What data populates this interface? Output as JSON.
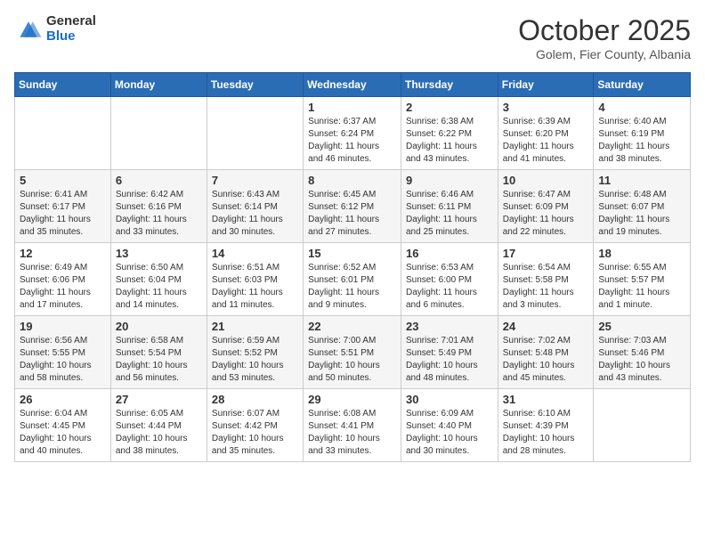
{
  "header": {
    "logo_general": "General",
    "logo_blue": "Blue",
    "month": "October 2025",
    "location": "Golem, Fier County, Albania"
  },
  "weekdays": [
    "Sunday",
    "Monday",
    "Tuesday",
    "Wednesday",
    "Thursday",
    "Friday",
    "Saturday"
  ],
  "weeks": [
    [
      {
        "day": "",
        "info": ""
      },
      {
        "day": "",
        "info": ""
      },
      {
        "day": "",
        "info": ""
      },
      {
        "day": "1",
        "info": "Sunrise: 6:37 AM\nSunset: 6:24 PM\nDaylight: 11 hours\nand 46 minutes."
      },
      {
        "day": "2",
        "info": "Sunrise: 6:38 AM\nSunset: 6:22 PM\nDaylight: 11 hours\nand 43 minutes."
      },
      {
        "day": "3",
        "info": "Sunrise: 6:39 AM\nSunset: 6:20 PM\nDaylight: 11 hours\nand 41 minutes."
      },
      {
        "day": "4",
        "info": "Sunrise: 6:40 AM\nSunset: 6:19 PM\nDaylight: 11 hours\nand 38 minutes."
      }
    ],
    [
      {
        "day": "5",
        "info": "Sunrise: 6:41 AM\nSunset: 6:17 PM\nDaylight: 11 hours\nand 35 minutes."
      },
      {
        "day": "6",
        "info": "Sunrise: 6:42 AM\nSunset: 6:16 PM\nDaylight: 11 hours\nand 33 minutes."
      },
      {
        "day": "7",
        "info": "Sunrise: 6:43 AM\nSunset: 6:14 PM\nDaylight: 11 hours\nand 30 minutes."
      },
      {
        "day": "8",
        "info": "Sunrise: 6:45 AM\nSunset: 6:12 PM\nDaylight: 11 hours\nand 27 minutes."
      },
      {
        "day": "9",
        "info": "Sunrise: 6:46 AM\nSunset: 6:11 PM\nDaylight: 11 hours\nand 25 minutes."
      },
      {
        "day": "10",
        "info": "Sunrise: 6:47 AM\nSunset: 6:09 PM\nDaylight: 11 hours\nand 22 minutes."
      },
      {
        "day": "11",
        "info": "Sunrise: 6:48 AM\nSunset: 6:07 PM\nDaylight: 11 hours\nand 19 minutes."
      }
    ],
    [
      {
        "day": "12",
        "info": "Sunrise: 6:49 AM\nSunset: 6:06 PM\nDaylight: 11 hours\nand 17 minutes."
      },
      {
        "day": "13",
        "info": "Sunrise: 6:50 AM\nSunset: 6:04 PM\nDaylight: 11 hours\nand 14 minutes."
      },
      {
        "day": "14",
        "info": "Sunrise: 6:51 AM\nSunset: 6:03 PM\nDaylight: 11 hours\nand 11 minutes."
      },
      {
        "day": "15",
        "info": "Sunrise: 6:52 AM\nSunset: 6:01 PM\nDaylight: 11 hours\nand 9 minutes."
      },
      {
        "day": "16",
        "info": "Sunrise: 6:53 AM\nSunset: 6:00 PM\nDaylight: 11 hours\nand 6 minutes."
      },
      {
        "day": "17",
        "info": "Sunrise: 6:54 AM\nSunset: 5:58 PM\nDaylight: 11 hours\nand 3 minutes."
      },
      {
        "day": "18",
        "info": "Sunrise: 6:55 AM\nSunset: 5:57 PM\nDaylight: 11 hours\nand 1 minute."
      }
    ],
    [
      {
        "day": "19",
        "info": "Sunrise: 6:56 AM\nSunset: 5:55 PM\nDaylight: 10 hours\nand 58 minutes."
      },
      {
        "day": "20",
        "info": "Sunrise: 6:58 AM\nSunset: 5:54 PM\nDaylight: 10 hours\nand 56 minutes."
      },
      {
        "day": "21",
        "info": "Sunrise: 6:59 AM\nSunset: 5:52 PM\nDaylight: 10 hours\nand 53 minutes."
      },
      {
        "day": "22",
        "info": "Sunrise: 7:00 AM\nSunset: 5:51 PM\nDaylight: 10 hours\nand 50 minutes."
      },
      {
        "day": "23",
        "info": "Sunrise: 7:01 AM\nSunset: 5:49 PM\nDaylight: 10 hours\nand 48 minutes."
      },
      {
        "day": "24",
        "info": "Sunrise: 7:02 AM\nSunset: 5:48 PM\nDaylight: 10 hours\nand 45 minutes."
      },
      {
        "day": "25",
        "info": "Sunrise: 7:03 AM\nSunset: 5:46 PM\nDaylight: 10 hours\nand 43 minutes."
      }
    ],
    [
      {
        "day": "26",
        "info": "Sunrise: 6:04 AM\nSunset: 4:45 PM\nDaylight: 10 hours\nand 40 minutes."
      },
      {
        "day": "27",
        "info": "Sunrise: 6:05 AM\nSunset: 4:44 PM\nDaylight: 10 hours\nand 38 minutes."
      },
      {
        "day": "28",
        "info": "Sunrise: 6:07 AM\nSunset: 4:42 PM\nDaylight: 10 hours\nand 35 minutes."
      },
      {
        "day": "29",
        "info": "Sunrise: 6:08 AM\nSunset: 4:41 PM\nDaylight: 10 hours\nand 33 minutes."
      },
      {
        "day": "30",
        "info": "Sunrise: 6:09 AM\nSunset: 4:40 PM\nDaylight: 10 hours\nand 30 minutes."
      },
      {
        "day": "31",
        "info": "Sunrise: 6:10 AM\nSunset: 4:39 PM\nDaylight: 10 hours\nand 28 minutes."
      },
      {
        "day": "",
        "info": ""
      }
    ]
  ]
}
